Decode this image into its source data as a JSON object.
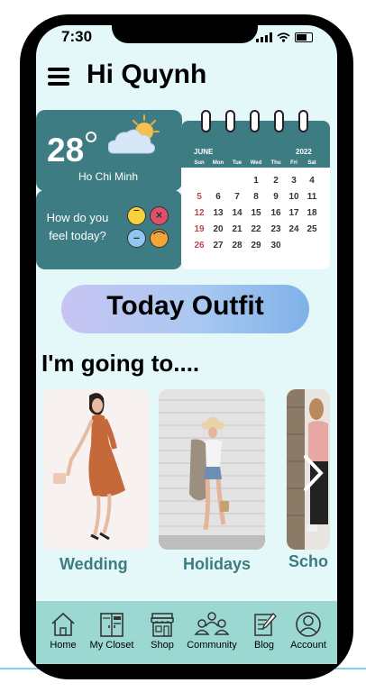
{
  "status": {
    "time": "7:30"
  },
  "header": {
    "greeting": "Hi Quynh"
  },
  "weather": {
    "temp": "28",
    "city": "Ho Chi Minh"
  },
  "mood": {
    "prompt": "How do you feel today?"
  },
  "calendar": {
    "month": "JUNE",
    "year": "2022",
    "days_of_week": [
      "Sun",
      "Mon",
      "Tue",
      "Wed",
      "Thu",
      "Fri",
      "Sat"
    ],
    "weeks": [
      [
        "",
        "",
        "",
        "1",
        "2",
        "3",
        "4"
      ],
      [
        "5",
        "6",
        "7",
        "8",
        "9",
        "10",
        "11"
      ],
      [
        "12",
        "13",
        "14",
        "15",
        "16",
        "17",
        "18"
      ],
      [
        "19",
        "20",
        "21",
        "22",
        "23",
        "24",
        "25"
      ],
      [
        "26",
        "27",
        "28",
        "29",
        "30",
        "",
        ""
      ]
    ]
  },
  "today_outfit": {
    "label": "Today Outfit"
  },
  "going": {
    "title": "I'm going to...."
  },
  "cards": [
    {
      "label": "Wedding"
    },
    {
      "label": "Holidays"
    },
    {
      "label": "Scho"
    }
  ],
  "nav": {
    "items": [
      {
        "label": "Home",
        "icon": "home-icon"
      },
      {
        "label": "My Closet",
        "icon": "closet-icon"
      },
      {
        "label": "Shop",
        "icon": "shop-icon"
      },
      {
        "label": "Community",
        "icon": "community-icon"
      },
      {
        "label": "Blog",
        "icon": "blog-icon"
      },
      {
        "label": "Account",
        "icon": "account-icon"
      }
    ]
  },
  "colors": {
    "teal": "#3d7c83",
    "screen_bg": "#e4f8f9",
    "nav_bg": "#9bd8d2",
    "accent_red": "#c0444f"
  }
}
